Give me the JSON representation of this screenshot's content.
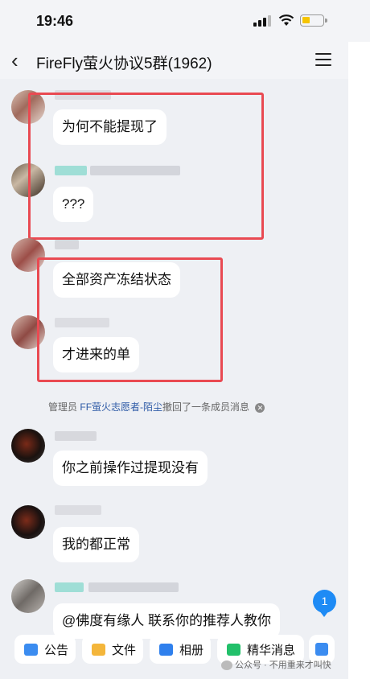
{
  "status_bar": {
    "time": "19:46"
  },
  "header": {
    "title": "FireFly萤火协议5群(1962)"
  },
  "messages": [
    {
      "text": "为何不能提现了"
    },
    {
      "text": "???"
    },
    {
      "text": "全部资产冻结状态"
    },
    {
      "text": "才进来的单"
    },
    {
      "text": "你之前操作过提现没有"
    },
    {
      "text": "我的都正常"
    },
    {
      "text": "@佛度有缘人 联系你的推荐人教你"
    }
  ],
  "system_notice": {
    "prefix": "管理员",
    "admin_name": "FF萤火志愿者-陌尘",
    "suffix": "撤回了一条成员消息"
  },
  "unread_count": "1",
  "bottom_bar": {
    "items": [
      {
        "label": "公告",
        "icon": "announcement-icon"
      },
      {
        "label": "文件",
        "icon": "folder-icon"
      },
      {
        "label": "相册",
        "icon": "album-icon"
      },
      {
        "label": "精华消息",
        "icon": "essence-icon"
      }
    ]
  },
  "watermark": "公众号 · 不用重来才叫快",
  "colors": {
    "highlight_box": "#e94a52",
    "accent": "#1e8bf5"
  }
}
